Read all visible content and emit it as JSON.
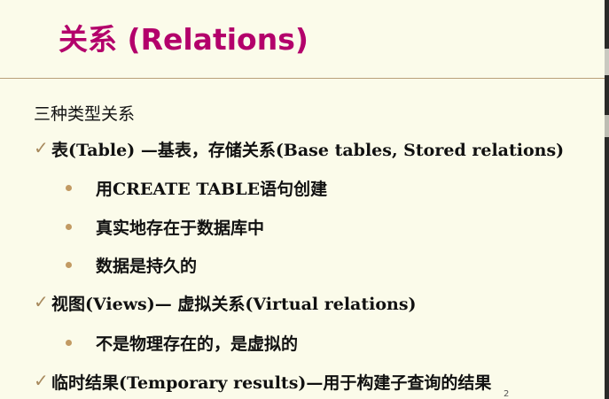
{
  "title": "关系 (Relations)",
  "intro": "三种类型关系",
  "items": [
    {
      "label": "表(Table) —基表，存储关系(Base tables, Stored relations)",
      "subitems": [
        "用CREATE TABLE语句创建",
        "真实地存在于数据库中",
        "数据是持久的"
      ]
    },
    {
      "label": "视图(Views)— 虚拟关系(Virtual relations)",
      "subitems": [
        "不是物理存在的，是虚拟的"
      ]
    },
    {
      "label": "临时结果(Temporary results)—用于构建子查询的结果",
      "subitems": []
    }
  ],
  "bullet_icons": {
    "item_marker": "check-icon",
    "subitem_marker": "dot-icon"
  },
  "colors": {
    "title": "#b3006b",
    "background": "#fbfbea",
    "marker": "#c29a63"
  },
  "page_number": "2"
}
